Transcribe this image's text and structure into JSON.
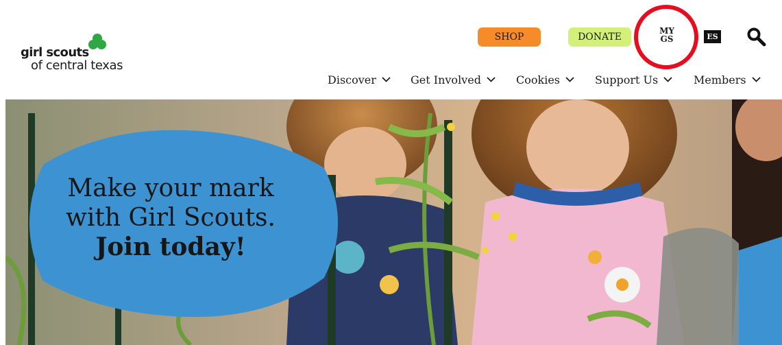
{
  "header": {
    "logo": {
      "line1": "girl scouts",
      "line2": "of central texas"
    },
    "shop_label": "SHOP",
    "donate_label": "DONATE",
    "mygs": {
      "line1": "MY",
      "line2": "GS"
    },
    "lang_label": "ES",
    "search_icon": "search-icon"
  },
  "nav": {
    "items": [
      {
        "label": "Discover"
      },
      {
        "label": "Get Involved"
      },
      {
        "label": "Cookies"
      },
      {
        "label": "Support Us"
      },
      {
        "label": "Members"
      }
    ]
  },
  "hero": {
    "headline": {
      "line1": "Make your mark",
      "line2": "with Girl Scouts.",
      "line3": "Join today!"
    }
  },
  "colors": {
    "shop": "#f68b2a",
    "donate": "#d2f07a",
    "brand_green": "#2fa844",
    "hero_blob": "#3d93d2",
    "highlight_circle": "#e60d1f"
  }
}
